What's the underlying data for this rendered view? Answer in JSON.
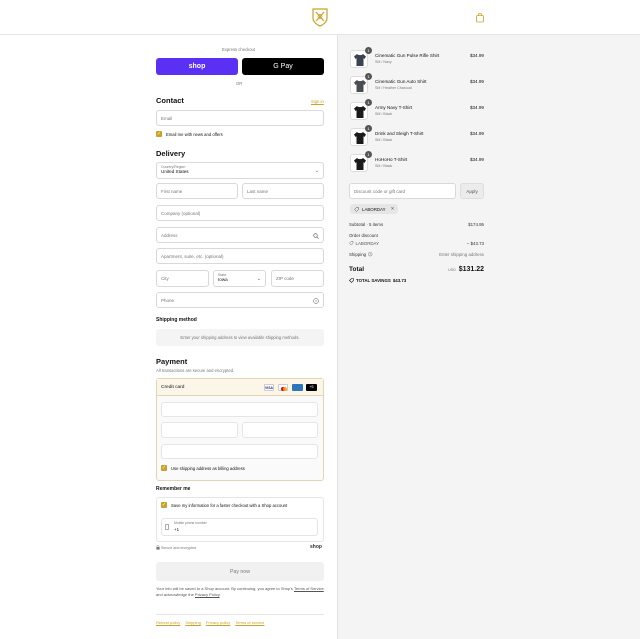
{
  "express": {
    "title": "Express checkout",
    "shop_label": "shop",
    "gpay_label": "G Pay",
    "or_label": "OR"
  },
  "contact": {
    "title": "Contact",
    "signin_label": "Sign in",
    "email_placeholder": "Email",
    "news_label": "Email me with news and offers"
  },
  "delivery": {
    "title": "Delivery",
    "country_label": "Country/Region",
    "country_value": "United States",
    "first_placeholder": "First name",
    "last_placeholder": "Last name",
    "company_placeholder": "Company (optional)",
    "address_placeholder": "Address",
    "apt_placeholder": "Apartment, suite, etc. (optional)",
    "city_placeholder": "City",
    "state_label": "State",
    "state_value": "Iowa",
    "zip_placeholder": "ZIP code",
    "phone_placeholder": "Phone"
  },
  "shipping": {
    "title": "Shipping method",
    "message": "Enter your shipping address to view available shipping methods."
  },
  "payment": {
    "title": "Payment",
    "subtitle": "All transactions are secure and encrypted.",
    "method_label": "Credit card",
    "more_cards": "+5",
    "billing_label": "Use shipping address as billing address"
  },
  "remember": {
    "title": "Remember me",
    "save_label": "Save my information for a faster checkout with a Shop account",
    "phone_label": "Mobile phone number",
    "phone_value": "+1",
    "secure_label": "Secure and encrypted",
    "shop_label": "shop"
  },
  "pay_button": "Pay now",
  "legal": {
    "prefix": "Your info will be saved to a Shop account. By continuing, you agree to Shop's ",
    "terms": "Terms of Service",
    "middle": " and acknowledge the ",
    "privacy": "Privacy Policy",
    "suffix": "."
  },
  "footer_links": [
    "Refund policy",
    "Shipping",
    "Privacy policy",
    "Terms of service"
  ],
  "cart": {
    "items": [
      {
        "name": "Cinematic Gun Pulse Rifle Shirt",
        "variant": "SM / Navy",
        "price": "$34.99",
        "qty": "1",
        "color": "#3a4150"
      },
      {
        "name": "Cinematic Gun Auto Shirt",
        "variant": "SM / Heather Charcoal",
        "price": "$34.99",
        "qty": "1",
        "color": "#4a4d52"
      },
      {
        "name": "Army Navy T-Shirt",
        "variant": "SM / Black",
        "price": "$34.99",
        "qty": "1",
        "color": "#1a1a1a"
      },
      {
        "name": "Drink and Sleigh T-Shirt",
        "variant": "SM / Black",
        "price": "$34.99",
        "qty": "1",
        "color": "#1a1a1a"
      },
      {
        "name": "HoHoHo T-Shirt",
        "variant": "SM / Black",
        "price": "$34.99",
        "qty": "1",
        "color": "#1a1a1a"
      }
    ],
    "discount_placeholder": "Discount code or gift card",
    "apply_label": "Apply",
    "code_tag": "LABORDAY",
    "subtotal_label": "Subtotal · 5 items",
    "subtotal_value": "$174.95",
    "order_discount_label": "Order discount",
    "discount_code": "LABORDAY",
    "discount_value": "– $43.73",
    "shipping_label": "Shipping",
    "shipping_value": "Enter shipping address",
    "total_label": "Total",
    "currency": "USD",
    "total_value": "$131.22",
    "savings_label": "TOTAL SAVINGS",
    "savings_value": "$43.73"
  },
  "colors": {
    "accent": "#c9a227",
    "shop_purple": "#5a31f4"
  }
}
